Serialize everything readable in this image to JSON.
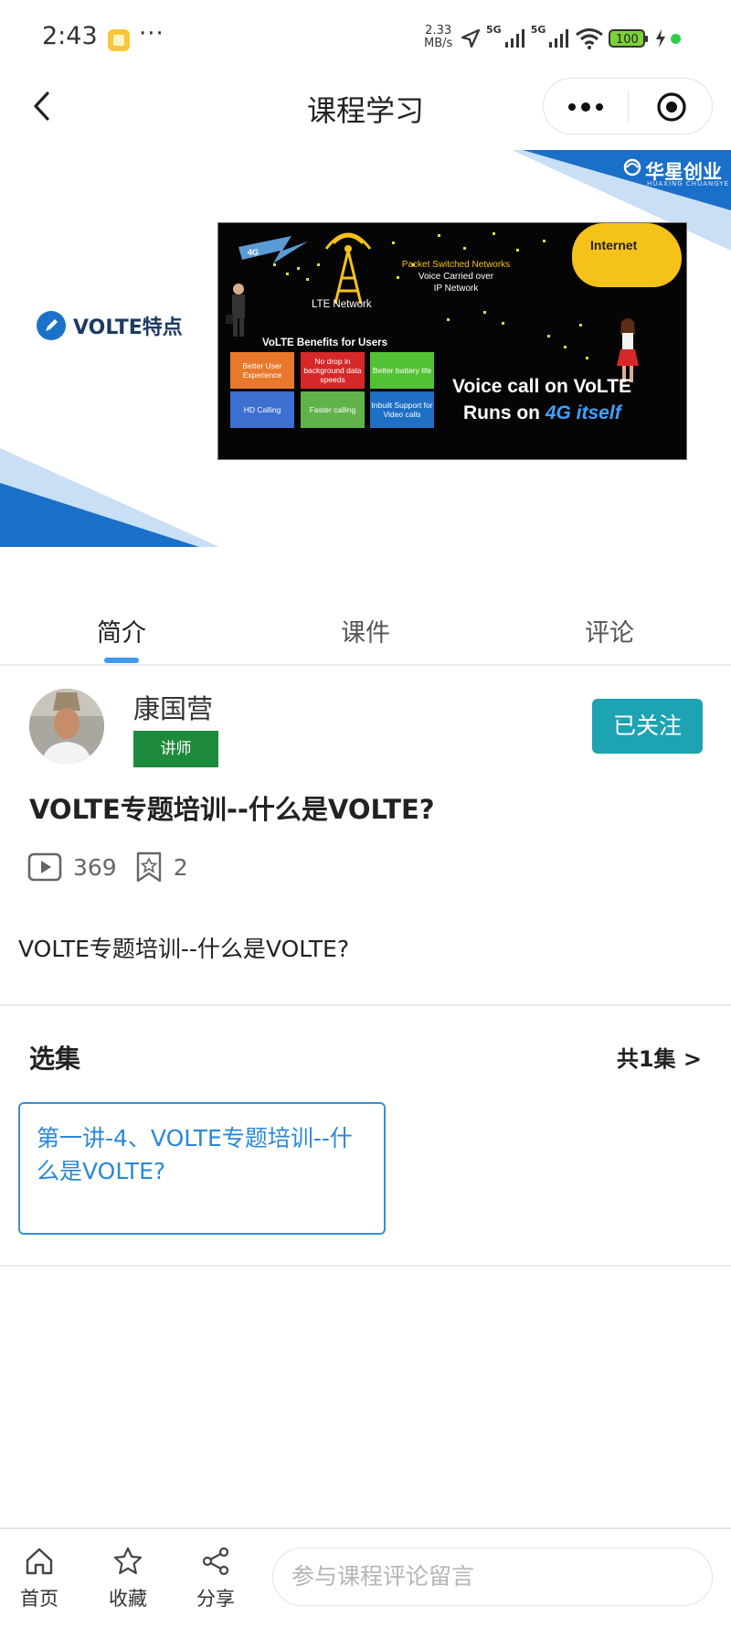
{
  "status_bar": {
    "time": "2:43",
    "more": "···",
    "speed_value": "2.33",
    "speed_unit": "MB/s",
    "sim1": "5G",
    "sim2": "5G",
    "battery": "100"
  },
  "nav": {
    "title": "课程学习"
  },
  "banner": {
    "brand": "华星创业",
    "brand_sub": "HUAXING CHUANGYE",
    "label": "VOLTE特点",
    "slide": {
      "tag_4g": "4G",
      "lte_network": "LTE Network",
      "packet_line1": "Packet Switched Networks",
      "packet_line2": "Voice Carried over",
      "packet_line3": "IP Network",
      "internet": "Internet",
      "benefits_title": "VoLTE Benefits for Users",
      "benefits": [
        "Better User Experience",
        "No drop in background data speeds",
        "Better battery life",
        "HD Calling",
        "Faster calling",
        "Inbuilt Support for Video calls"
      ],
      "headline1": "Voice call on VoLTE",
      "headline2_prefix": "Runs on ",
      "headline2_emph": "4G itself"
    }
  },
  "tabs": [
    {
      "label": "简介",
      "active": true
    },
    {
      "label": "课件",
      "active": false
    },
    {
      "label": "评论",
      "active": false
    }
  ],
  "teacher": {
    "name": "康国营",
    "badge": "讲师",
    "follow_label": "已关注"
  },
  "course": {
    "title": "VOLTE专题培训--什么是VOLTE?",
    "views": "369",
    "favorites": "2",
    "description": "VOLTE专题培训--什么是VOLTE?"
  },
  "episodes": {
    "title": "选集",
    "count": "共1集 >",
    "items": [
      {
        "label": "第一讲-4、VOLTE专题培训--什么是VOLTE?"
      }
    ]
  },
  "bottom_bar": {
    "home": "首页",
    "favorite": "收藏",
    "share": "分享",
    "comment_placeholder": "参与课程评论留言"
  },
  "colors": {
    "accent_blue": "#3f9af0",
    "follow_teal": "#1ea3b2",
    "badge_green": "#1e8a3c",
    "episode_blue": "#2a88d8",
    "banner_blue": "#1a6fc8"
  }
}
